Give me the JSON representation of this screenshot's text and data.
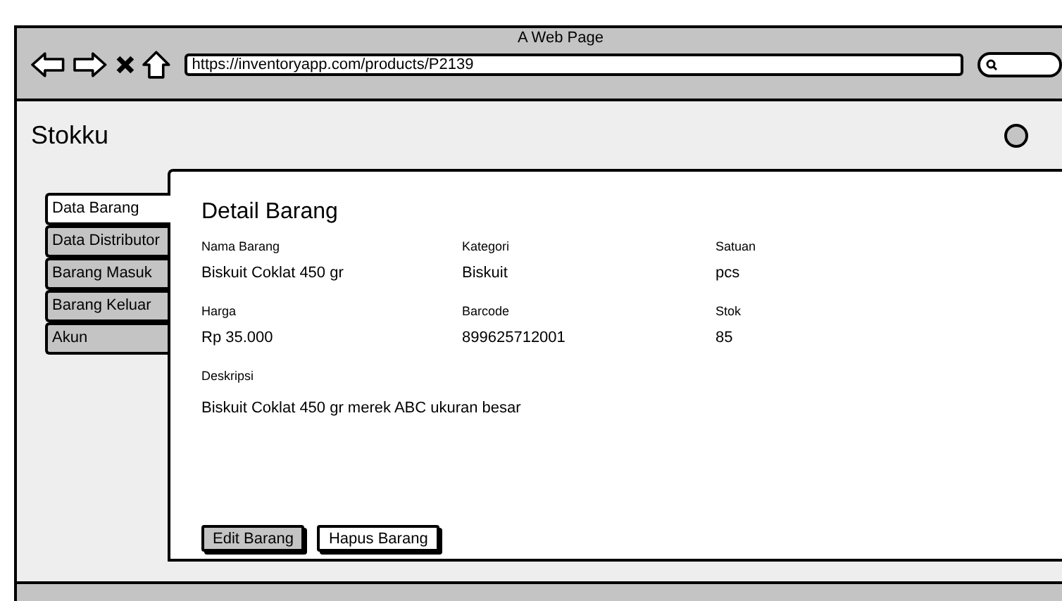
{
  "browser": {
    "title": "A Web Page",
    "url": "https://inventoryapp.com/products/P2139"
  },
  "app": {
    "title": "Stokku"
  },
  "nav_tabs": [
    {
      "label": "Data Barang",
      "selected": true
    },
    {
      "label": "Data Distributor",
      "selected": false
    },
    {
      "label": "Barang Masuk",
      "selected": false
    },
    {
      "label": "Barang Keluar",
      "selected": false
    },
    {
      "label": "Akun",
      "selected": false
    }
  ],
  "detail": {
    "title": "Detail Barang",
    "fields": [
      {
        "label": "Nama Barang",
        "value": "Biskuit Coklat 450 gr"
      },
      {
        "label": "Kategori",
        "value": "Biskuit"
      },
      {
        "label": "Satuan",
        "value": "pcs"
      },
      {
        "label": "Harga",
        "value": "Rp 35.000"
      },
      {
        "label": "Barcode",
        "value": "899625712001"
      },
      {
        "label": "Stok",
        "value": "85"
      }
    ],
    "description": {
      "label": "Deskripsi",
      "value": "Biskuit Coklat 450 gr merek ABC ukuran besar"
    },
    "buttons": [
      {
        "label": "Edit Barang",
        "selected": true
      },
      {
        "label": "Hapus Barang",
        "selected": false
      }
    ]
  }
}
